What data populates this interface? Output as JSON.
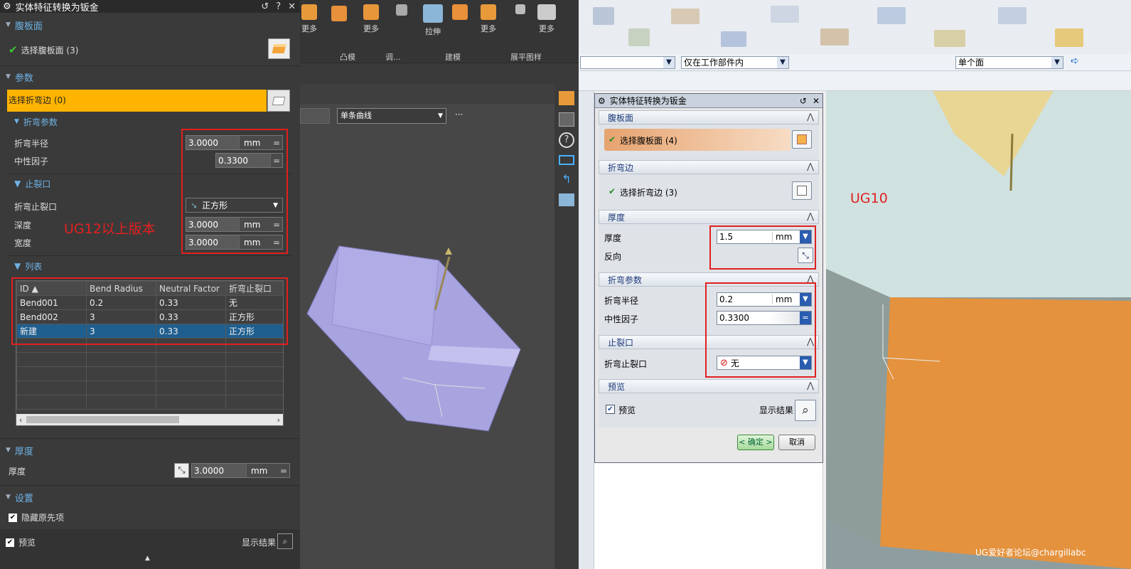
{
  "left": {
    "title": "实体特征转换为钣金",
    "title_btns": [
      "↺",
      "?",
      "✕"
    ],
    "web": {
      "header": "腹板面",
      "select": "选择腹板面 (3)"
    },
    "params": {
      "header": "参数",
      "select_edge": "选择折弯边 (0)",
      "bend_hdr": "折弯参数",
      "bend_radius_label": "折弯半径",
      "bend_radius": "3.0000",
      "unit_mm": "mm",
      "neutral_label": "中性因子",
      "neutral": "0.3300",
      "relief_hdr": "止裂口",
      "relief_label": "折弯止裂口",
      "relief_value": "正方形",
      "depth_label": "深度",
      "depth": "3.0000",
      "width_label": "宽度",
      "width": "3.0000"
    },
    "annotation": "UG12以上版本",
    "list": {
      "header": "列表",
      "columns": [
        "ID",
        "Bend Radius",
        "Neutral Factor",
        "折弯止裂口"
      ],
      "rows": [
        [
          "Bend001",
          "0.2",
          "0.33",
          "无"
        ],
        [
          "Bend002",
          "3",
          "0.33",
          "正方形"
        ],
        [
          "新建",
          "3",
          "0.33",
          "正方形"
        ]
      ]
    },
    "thickness": {
      "header": "厚度",
      "label": "厚度",
      "value": "3.0000",
      "unit": "mm"
    },
    "settings": {
      "header": "设置",
      "hide_original": "隐藏原先项"
    },
    "preview": {
      "label": "预览",
      "show_result": "显示结果"
    }
  },
  "cad": {
    "ribbon": [
      "更多",
      "更多",
      "拉伸",
      "更多",
      "更多",
      "更多"
    ],
    "groups": [
      "凸模",
      "调...",
      "建模",
      "展平图样"
    ],
    "curve_combo": "单条曲线",
    "more": "···"
  },
  "right": {
    "combo_scope": "仅在工作部件内",
    "combo_face": "单个面",
    "annotation": "UG10",
    "title": "实体特征转换为钣金",
    "web": {
      "header": "腹板面",
      "select": "选择腹板面 (4)"
    },
    "edge": {
      "header": "折弯边",
      "select": "选择折弯边 (3)"
    },
    "thick": {
      "header": "厚度",
      "label": "厚度",
      "value": "1.5",
      "unit": "mm",
      "reverse": "反向"
    },
    "bend": {
      "header": "折弯参数",
      "radius_label": "折弯半径",
      "radius": "0.2",
      "unit": "mm",
      "neutral_label": "中性因子",
      "neutral": "0.3300"
    },
    "relief": {
      "header": "止裂口",
      "label": "折弯止裂口",
      "value": "无"
    },
    "preview": {
      "header": "预览",
      "label": "预览",
      "show": "显示结果"
    },
    "ok": "< 确定 >",
    "cancel": "取消",
    "watermark": "UG爱好者论坛@chargillabc"
  }
}
